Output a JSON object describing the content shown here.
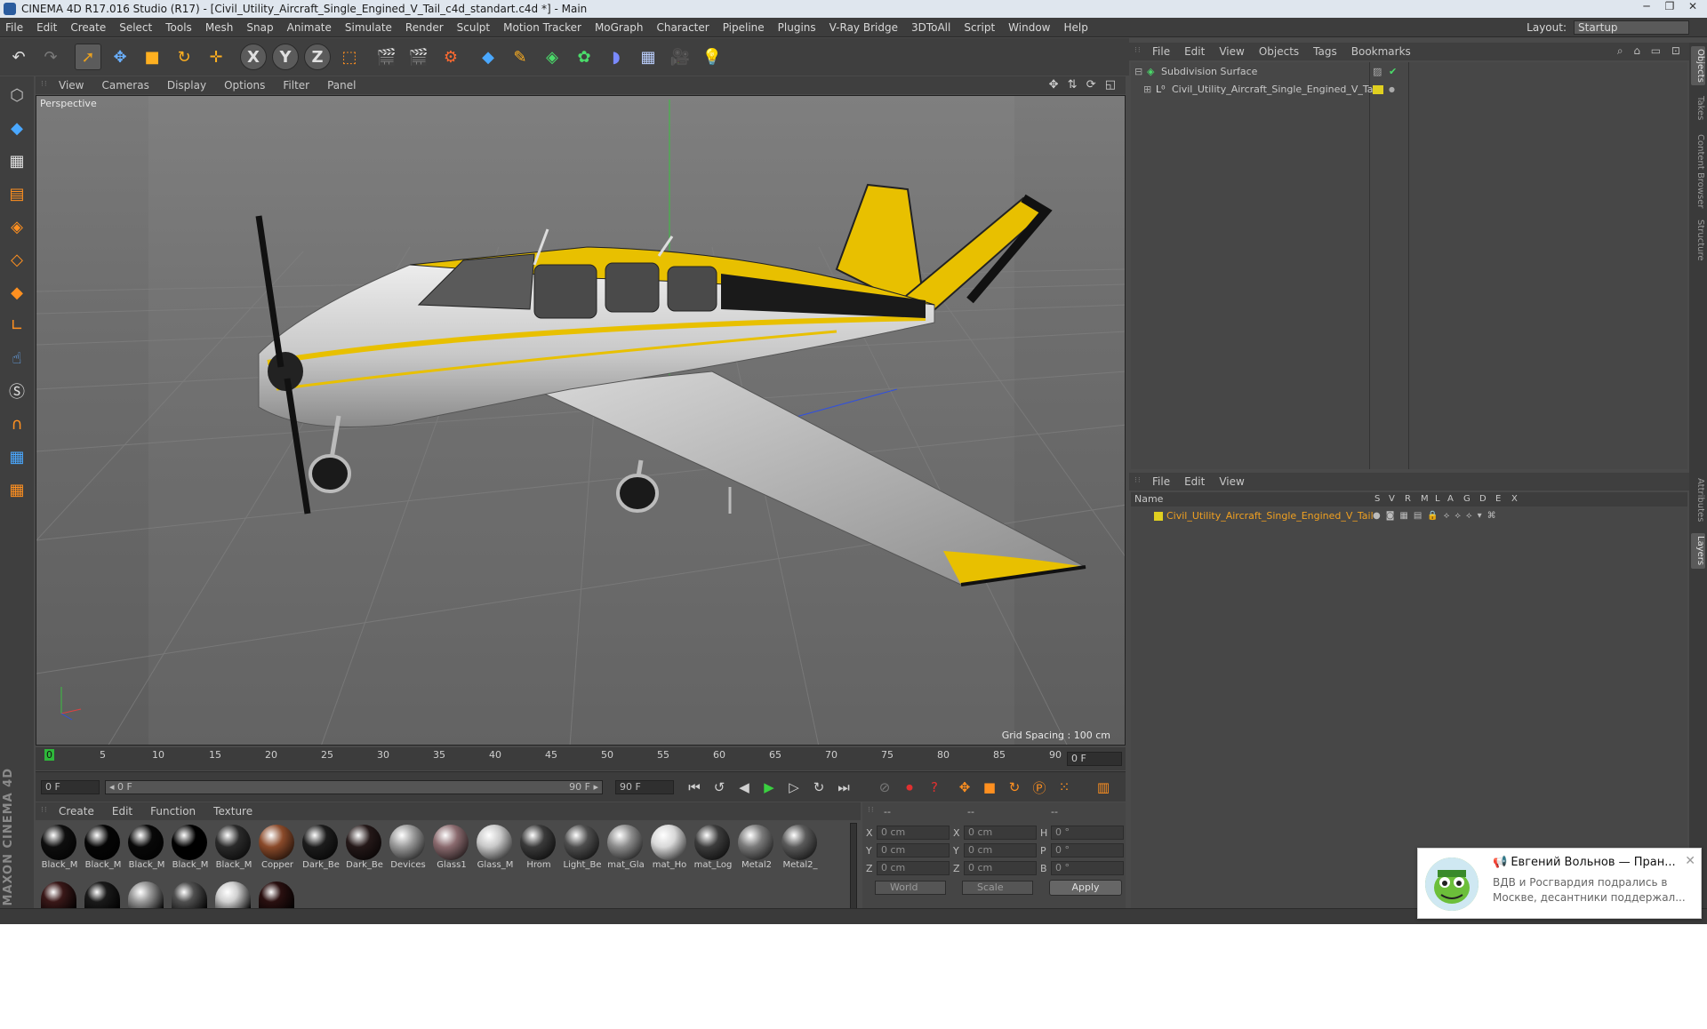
{
  "window": {
    "title": "CINEMA 4D R17.016 Studio (R17) - [Civil_Utility_Aircraft_Single_Engined_V_Tail_c4d_standart.c4d *] - Main",
    "minimize": "─",
    "maximize": "❐",
    "close": "✕"
  },
  "menubar": {
    "items": [
      "File",
      "Edit",
      "Create",
      "Select",
      "Tools",
      "Mesh",
      "Snap",
      "Animate",
      "Simulate",
      "Render",
      "Sculpt",
      "Motion Tracker",
      "MoGraph",
      "Character",
      "Pipeline",
      "Plugins",
      "V-Ray Bridge",
      "3DToAll",
      "Script",
      "Window",
      "Help"
    ],
    "layout_label": "Layout:",
    "layout_value": "Startup"
  },
  "toolbar": {
    "icons": [
      "undo-icon",
      "redo-icon",
      "select-icon",
      "move-icon",
      "scale-icon",
      "rotate-icon",
      "live-select-icon",
      "x-axis-icon",
      "y-axis-icon",
      "z-axis-icon",
      "coordinate-system-icon",
      "render-view-icon",
      "render-picture-viewer-icon",
      "render-settings-icon",
      "cube-icon",
      "pen-icon",
      "subdivision-icon",
      "cloner-icon",
      "deformer-icon",
      "floor-icon",
      "camera-icon",
      "light-icon"
    ],
    "axis_x": "X",
    "axis_y": "Y",
    "axis_z": "Z"
  },
  "viewport": {
    "menu": [
      "View",
      "Cameras",
      "Display",
      "Options",
      "Filter",
      "Panel"
    ],
    "label": "Perspective",
    "grid_spacing": "Grid Spacing : 100 cm",
    "nav_icons": "✥ ⇅ ⟳ ◱"
  },
  "timeline": {
    "ticks": [
      "0",
      "5",
      "10",
      "15",
      "20",
      "25",
      "30",
      "35",
      "40",
      "45",
      "50",
      "55",
      "60",
      "65",
      "70",
      "75",
      "80",
      "85",
      "90"
    ],
    "current_frame": "0 F",
    "start_field": "0 F",
    "range_start": "◂ 0 F",
    "range_end": "90 F ▸",
    "end_field": "90 F"
  },
  "materials": {
    "menu": [
      "Create",
      "Edit",
      "Function",
      "Texture"
    ],
    "row1": [
      {
        "name": "Black_M",
        "color": "#0e0e0e"
      },
      {
        "name": "Black_M",
        "color": "#050505"
      },
      {
        "name": "Black_M",
        "color": "#080808"
      },
      {
        "name": "Black_M",
        "color": "#000000"
      },
      {
        "name": "Black_M",
        "color": "#2a2a2a"
      },
      {
        "name": "Copper",
        "color": "#8a4a2a"
      },
      {
        "name": "Dark_Be",
        "color": "#1c1c1c"
      },
      {
        "name": "Dark_Be",
        "color": "#241818"
      },
      {
        "name": "Devices",
        "color": "#9a9a9a"
      },
      {
        "name": "Glass1",
        "color": "#8a6a6e"
      },
      {
        "name": "Glass_M",
        "color": "#c8c8c8"
      },
      {
        "name": "Hrom",
        "color": "#3a3a3a"
      },
      {
        "name": "Light_Be",
        "color": "#4e4e4e"
      },
      {
        "name": "mat_Gla",
        "color": "#8c8c8c"
      },
      {
        "name": "mat_Ho",
        "color": "#d8d8d8"
      },
      {
        "name": "mat_Log",
        "color": "#3c3c3c"
      },
      {
        "name": "Metal2",
        "color": "#7a7a7a"
      },
      {
        "name": "Metal2_",
        "color": "#5a5a5a"
      }
    ],
    "row2_colors": [
      "#3a1818",
      "#1a1a1a",
      "#9a9a9a",
      "#505050",
      "#d0d0d0",
      "#2a1010"
    ]
  },
  "coords": {
    "header": [
      "--",
      "--",
      "--"
    ],
    "rows": [
      {
        "l1": "X",
        "v1": "0 cm",
        "l2": "X",
        "v2": "0 cm",
        "l3": "H",
        "v3": "0 °"
      },
      {
        "l1": "Y",
        "v1": "0 cm",
        "l2": "Y",
        "v2": "0 cm",
        "l3": "P",
        "v3": "0 °"
      },
      {
        "l1": "Z",
        "v1": "0 cm",
        "l2": "Z",
        "v2": "0 cm",
        "l3": "B",
        "v3": "0 °"
      }
    ],
    "world": "World",
    "scale": "Scale",
    "apply": "Apply"
  },
  "object_manager": {
    "menu": [
      "File",
      "Edit",
      "View",
      "Objects",
      "Tags",
      "Bookmarks"
    ],
    "objects": [
      {
        "name": "Subdivision Surface",
        "color": "#d0d0d0"
      },
      {
        "name": "Civil_Utility_Aircraft_Single_Engined_V_Tail",
        "color": "#c8c8c8"
      }
    ],
    "tag_color": "#e0d020"
  },
  "layer_manager": {
    "menu": [
      "File",
      "Edit",
      "View"
    ],
    "name_header": "Name",
    "columns": [
      "S",
      "V",
      "R",
      "M",
      "L",
      "A",
      "G",
      "D",
      "E",
      "X"
    ],
    "layer_name": "Civil_Utility_Aircraft_Single_Engined_V_Tail",
    "layer_color": "#f0a020"
  },
  "right_tabs": [
    "Objects",
    "Takes",
    "Content Browser",
    "Structure",
    "Attributes",
    "Layers"
  ],
  "brand": "MAXON CINEMA 4D",
  "notification": {
    "title": "📢 Евгений Вольнов — Пран...",
    "body": "ВДВ и Росгвардия подрались в Москве, десантники поддержал...",
    "close": "✕"
  },
  "colors": {
    "accent_yellow": "#e8c000",
    "viewport_bg": "#6d6d6d"
  }
}
